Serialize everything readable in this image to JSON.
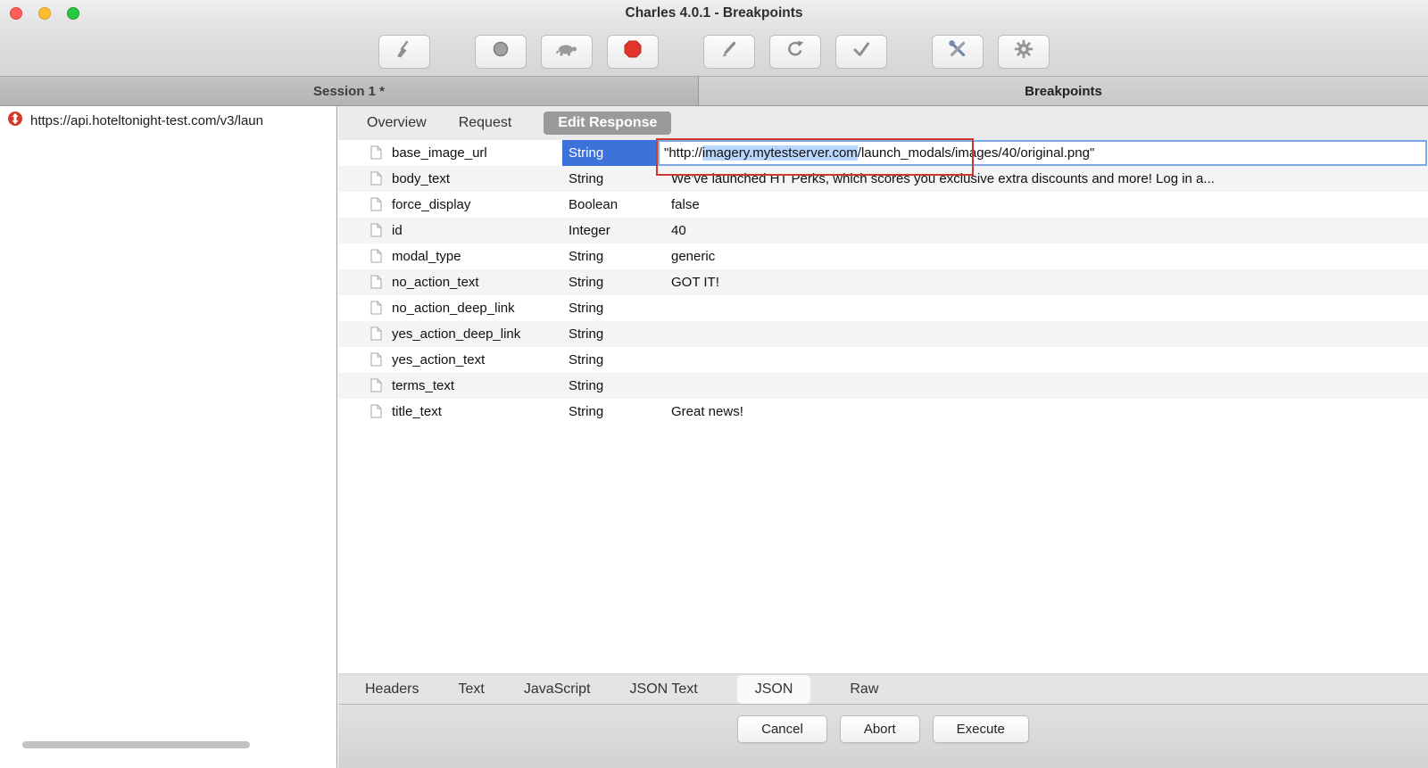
{
  "window": {
    "title": "Charles 4.0.1 - Breakpoints"
  },
  "toolbar": {
    "icons": [
      "broom",
      "record",
      "throttle-turtle",
      "breakpoint-stop",
      "compose-pencil",
      "repeat",
      "validate-check",
      "tools",
      "settings-gear"
    ]
  },
  "session_tabs": {
    "left": "Session 1 *",
    "right": "Breakpoints"
  },
  "sidebar": {
    "entries": [
      {
        "url": "https://api.hoteltonight-test.com/v3/laun"
      }
    ]
  },
  "editor": {
    "tabs": {
      "overview": "Overview",
      "request": "Request",
      "edit_response": "Edit Response",
      "active": "Edit Response"
    },
    "rows": [
      {
        "name": "base_image_url",
        "type": "String",
        "value": "\"http://imagery.mytestserver.com/launch_modals/images/40/original.png\"",
        "value_prefix": "\"http://",
        "value_selected": "imagery.mytestserver.com",
        "value_suffix": "/launch_modals/images/40/original.png\"",
        "selected": true
      },
      {
        "name": "body_text",
        "type": "String",
        "value": "We’ve launched HT Perks, which scores you exclusive extra discounts and more! Log in a..."
      },
      {
        "name": "force_display",
        "type": "Boolean",
        "value": "false"
      },
      {
        "name": "id",
        "type": "Integer",
        "value": "40"
      },
      {
        "name": "modal_type",
        "type": "String",
        "value": "generic"
      },
      {
        "name": "no_action_text",
        "type": "String",
        "value": "GOT IT!"
      },
      {
        "name": "no_action_deep_link",
        "type": "String",
        "value": ""
      },
      {
        "name": "yes_action_deep_link",
        "type": "String",
        "value": ""
      },
      {
        "name": "yes_action_text",
        "type": "String",
        "value": ""
      },
      {
        "name": "terms_text",
        "type": "String",
        "value": ""
      },
      {
        "name": "title_text",
        "type": "String",
        "value": "Great news!"
      }
    ],
    "bottom_tabs": {
      "labels": [
        "Headers",
        "Text",
        "JavaScript",
        "JSON Text",
        "JSON",
        "Raw"
      ],
      "active": "JSON"
    }
  },
  "footer": {
    "cancel": "Cancel",
    "abort": "Abort",
    "execute": "Execute"
  },
  "colors": {
    "selected_type_bg": "#3c72d9",
    "text_selection": "#b9d7fc",
    "annotation_red": "#cd3a31",
    "breakpoint_red": "#e2352b"
  }
}
